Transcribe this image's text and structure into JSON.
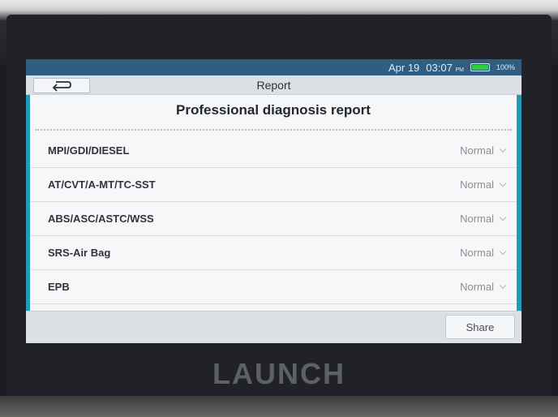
{
  "status_bar": {
    "date": "Apr 19",
    "time": "03:07",
    "ampm": "PM",
    "battery_percent": "100%",
    "battery_level": 1.0
  },
  "header": {
    "title": "Report",
    "back_icon": "back-arrow-icon"
  },
  "report": {
    "heading": "Professional diagnosis report",
    "rows": [
      {
        "label": "MPI/GDI/DIESEL",
        "status": "Normal"
      },
      {
        "label": "AT/CVT/A-MT/TC-SST",
        "status": "Normal"
      },
      {
        "label": "ABS/ASC/ASTC/WSS",
        "status": "Normal"
      },
      {
        "label": "SRS-Air Bag",
        "status": "Normal"
      },
      {
        "label": "EPB",
        "status": "Normal"
      }
    ]
  },
  "footer": {
    "share_label": "Share"
  },
  "device": {
    "brand": "LAUNCH"
  },
  "colors": {
    "status_bar": "#2f5e82",
    "accent": "#1f9bb8",
    "battery": "#2cd23a"
  }
}
